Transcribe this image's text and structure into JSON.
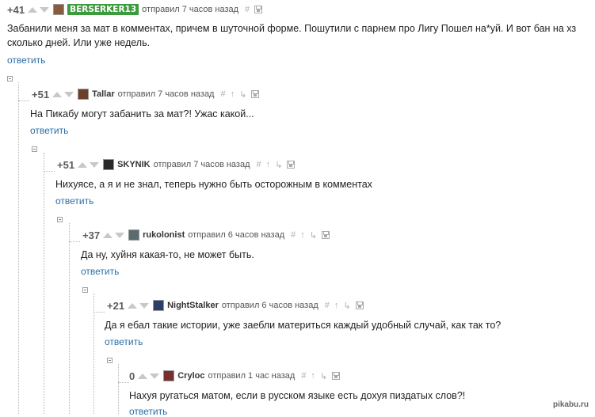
{
  "comments": [
    {
      "rating": "+41",
      "user": "BERSERKER13",
      "meta": "отправил 7 часов назад",
      "text": "Забанили меня за мат в комментах, причем в шуточной форме. Пошутили с парнем про Лигу Пошел на*уй. И вот бан на хз сколько дней. Или уже недель.",
      "reply": "ответить",
      "avatar_color": "#8a5b3a",
      "badge": true
    },
    {
      "rating": "+51",
      "user": "Tallar",
      "meta": "отправил 7 часов назад",
      "text": "На Пикабу могут забанить за мат?! Ужас какой...",
      "reply": "ответить",
      "avatar_color": "#6b3f2a"
    },
    {
      "rating": "+51",
      "user": "SKYNIK",
      "meta": "отправил 7 часов назад",
      "text": "Нихуясе, а я и не знал, теперь нужно быть осторожным в комментах",
      "reply": "ответить",
      "avatar_color": "#2a2a2a"
    },
    {
      "rating": "+37",
      "user": "rukolonist",
      "meta": "отправил 6 часов назад",
      "text": "Да ну, хуйня какая-то, не может быть.",
      "reply": "ответить",
      "avatar_color": "#5a6b6e"
    },
    {
      "rating": "+21",
      "user": "NightStalker",
      "meta": "отправил 6 часов назад",
      "text": "Да я ебал такие истории, уже заебли материться каждый удобный случай, как так то?",
      "reply": "ответить",
      "avatar_color": "#2b3e6a"
    },
    {
      "rating": "0",
      "user": "Cryloc",
      "meta": "отправил 1 час назад",
      "text": "Нахуя ругаться матом, если в русском языке есть дохуя пиздатых слов?!",
      "reply": "ответить",
      "avatar_color": "#7a2f2f"
    }
  ],
  "watermark": "pikabu.ru",
  "colors": {
    "link": "#2a6fa8",
    "badge": "#3c9b3c"
  }
}
